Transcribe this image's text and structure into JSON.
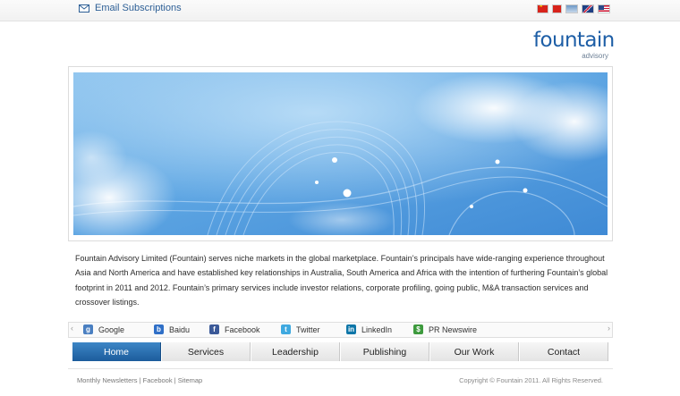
{
  "topbar": {
    "email_label": "Email Subscriptions",
    "flags": [
      "cn-flag-icon",
      "hk-flag-icon",
      "tw-flag-icon",
      "uk-flag-icon",
      "us-flag-icon"
    ]
  },
  "logo": {
    "word": "fountain",
    "sub": "advisory",
    "color": "#1d5ea6"
  },
  "intro": {
    "text": "Fountain Advisory Limited (Fountain) serves niche markets in the global marketplace. Fountain’s principals have wide-ranging experience throughout Asia and North America and have established key relationships in Australia, South America and Africa with the intention of furthering Fountain’s global footprint in 2011 and 2012. Fountain’s primary services include investor relations, corporate profiling, going public, M&A transaction services and crossover listings."
  },
  "share": {
    "items": [
      {
        "label": "Google",
        "icon": "google-icon",
        "color": "#4a7fc1"
      },
      {
        "label": "Baidu",
        "icon": "baidu-icon",
        "color": "#2f6fc7"
      },
      {
        "label": "Facebook",
        "icon": "facebook-icon",
        "color": "#3b5998"
      },
      {
        "label": "Twitter",
        "icon": "twitter-icon",
        "color": "#3fa9e0"
      },
      {
        "label": "LinkedIn",
        "icon": "linkedin-icon",
        "color": "#0e76a8"
      },
      {
        "label": "PR Newswire",
        "icon": "prnewswire-icon",
        "color": "#3d9a3d"
      }
    ]
  },
  "nav": {
    "items": [
      "Home",
      "Services",
      "Leadership",
      "Publishing",
      "Our Work",
      "Contact"
    ],
    "active": "Home",
    "accent": "#1f609f"
  },
  "footer": {
    "link1": "Monthly Newsletters",
    "link2": "Facebook",
    "link3": "Sitemap",
    "separator": " | ",
    "copyright": "Copyright © Fountain 2011. All Rights Reserved."
  }
}
